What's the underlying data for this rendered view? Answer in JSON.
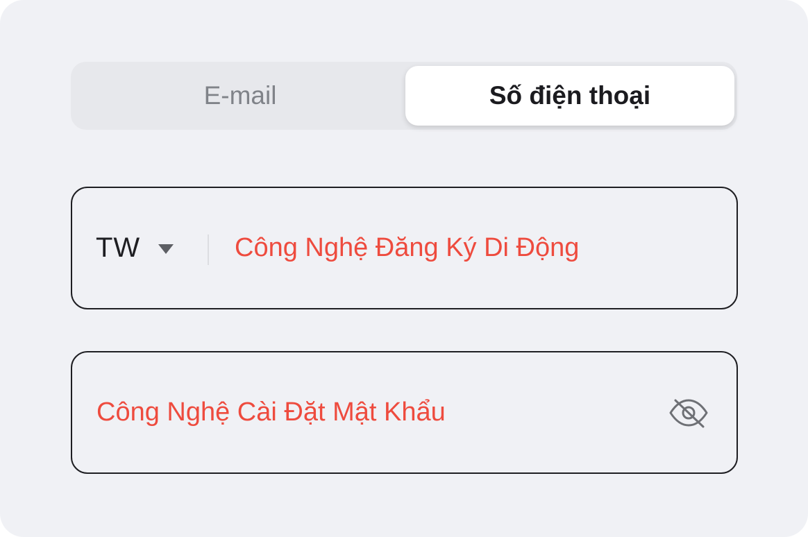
{
  "tabs": {
    "email_label": "E-mail",
    "phone_label": "Số điện thoại",
    "active": "phone"
  },
  "phone_field": {
    "country_code": "TW",
    "caret_icon": "caret-down-icon",
    "value": "Công Nghệ Đăng Ký Di Động"
  },
  "password_field": {
    "value": "Công Nghệ Cài Đặt Mật Khẩu",
    "visibility_icon": "eye-off-icon"
  },
  "colors": {
    "background": "#f0f1f5",
    "tab_track": "#e7e8ec",
    "active_tab": "#ffffff",
    "field_text": "#ee4b3e",
    "border": "#1e1e22",
    "muted_text": "#808389"
  }
}
